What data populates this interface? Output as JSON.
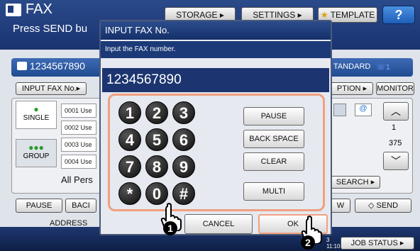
{
  "app": {
    "title": "FAX",
    "subtitle": "Press SEND bu"
  },
  "top_tabs": {
    "storage": "STORAGE",
    "settings": "SETTINGS",
    "template": "TEMPLATE",
    "help": "?"
  },
  "fax_row": {
    "number": "1234567890",
    "standard": "TANDARD",
    "count": "1"
  },
  "buttons": {
    "input_fax_no": "INPUT FAX No.",
    "option": "PTION",
    "monitor": "MONITOR"
  },
  "address_tabs": {
    "single": "SINGLE",
    "group": "GROUP"
  },
  "address_rows": [
    "0001 Use",
    "0002 Use",
    "0003 Use",
    "0004 Use"
  ],
  "all_persons": "All Pers",
  "pager": {
    "current": "1",
    "total": "375"
  },
  "search": "SEARCH",
  "bottom_buttons": {
    "pause": "PAUSE",
    "back": "BACI",
    "address": "ADDRESS",
    "send": "SEND",
    "w": "W"
  },
  "job_status": "JOB STATUS",
  "clock": {
    "line1": "3",
    "line2": "11:10"
  },
  "dialog": {
    "title": "INPUT FAX No.",
    "instruction": "Input the FAX number.",
    "display_value": "1234567890",
    "keys": [
      "1",
      "2",
      "3",
      "4",
      "5",
      "6",
      "7",
      "8",
      "9",
      "*",
      "0",
      "#"
    ],
    "functions": {
      "pause": "PAUSE",
      "backspace": "BACK SPACE",
      "clear": "CLEAR",
      "multi": "MULTI"
    },
    "cancel": "CANCEL",
    "ok": "OK"
  },
  "callouts": {
    "first": "1",
    "second": "2"
  },
  "colors": {
    "header": "#1f3d7a",
    "highlight": "#f0a080",
    "key": "#111111"
  }
}
